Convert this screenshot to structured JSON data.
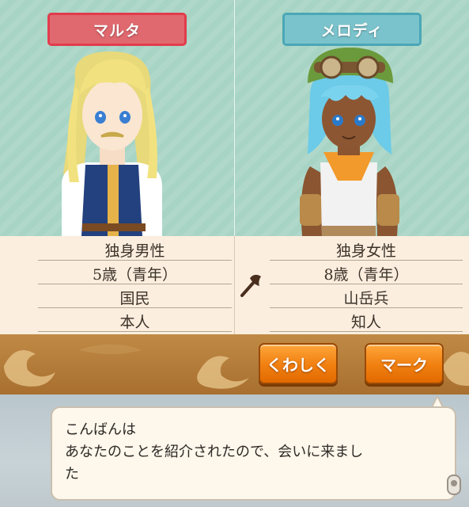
{
  "characters": [
    {
      "name": "マルタ",
      "info": [
        "独身男性",
        "5歳（青年）",
        "国民",
        "本人"
      ]
    },
    {
      "name": "メロディ",
      "info": [
        "独身女性",
        "8歳（青年）",
        "山岳兵",
        "知人"
      ]
    }
  ],
  "buttons": {
    "detail": "くわしく",
    "mark": "マーク"
  },
  "dialogue": {
    "text": "こんばんは\nあなたのことを紹介されたので、会いに来まし\nた"
  },
  "colors": {
    "left_tag": "#e0696f",
    "right_tag": "#7bc3cc",
    "button": "#f07f10"
  },
  "icons": {
    "relation": "axe-icon",
    "advance": "scroll-cursor-icon"
  }
}
